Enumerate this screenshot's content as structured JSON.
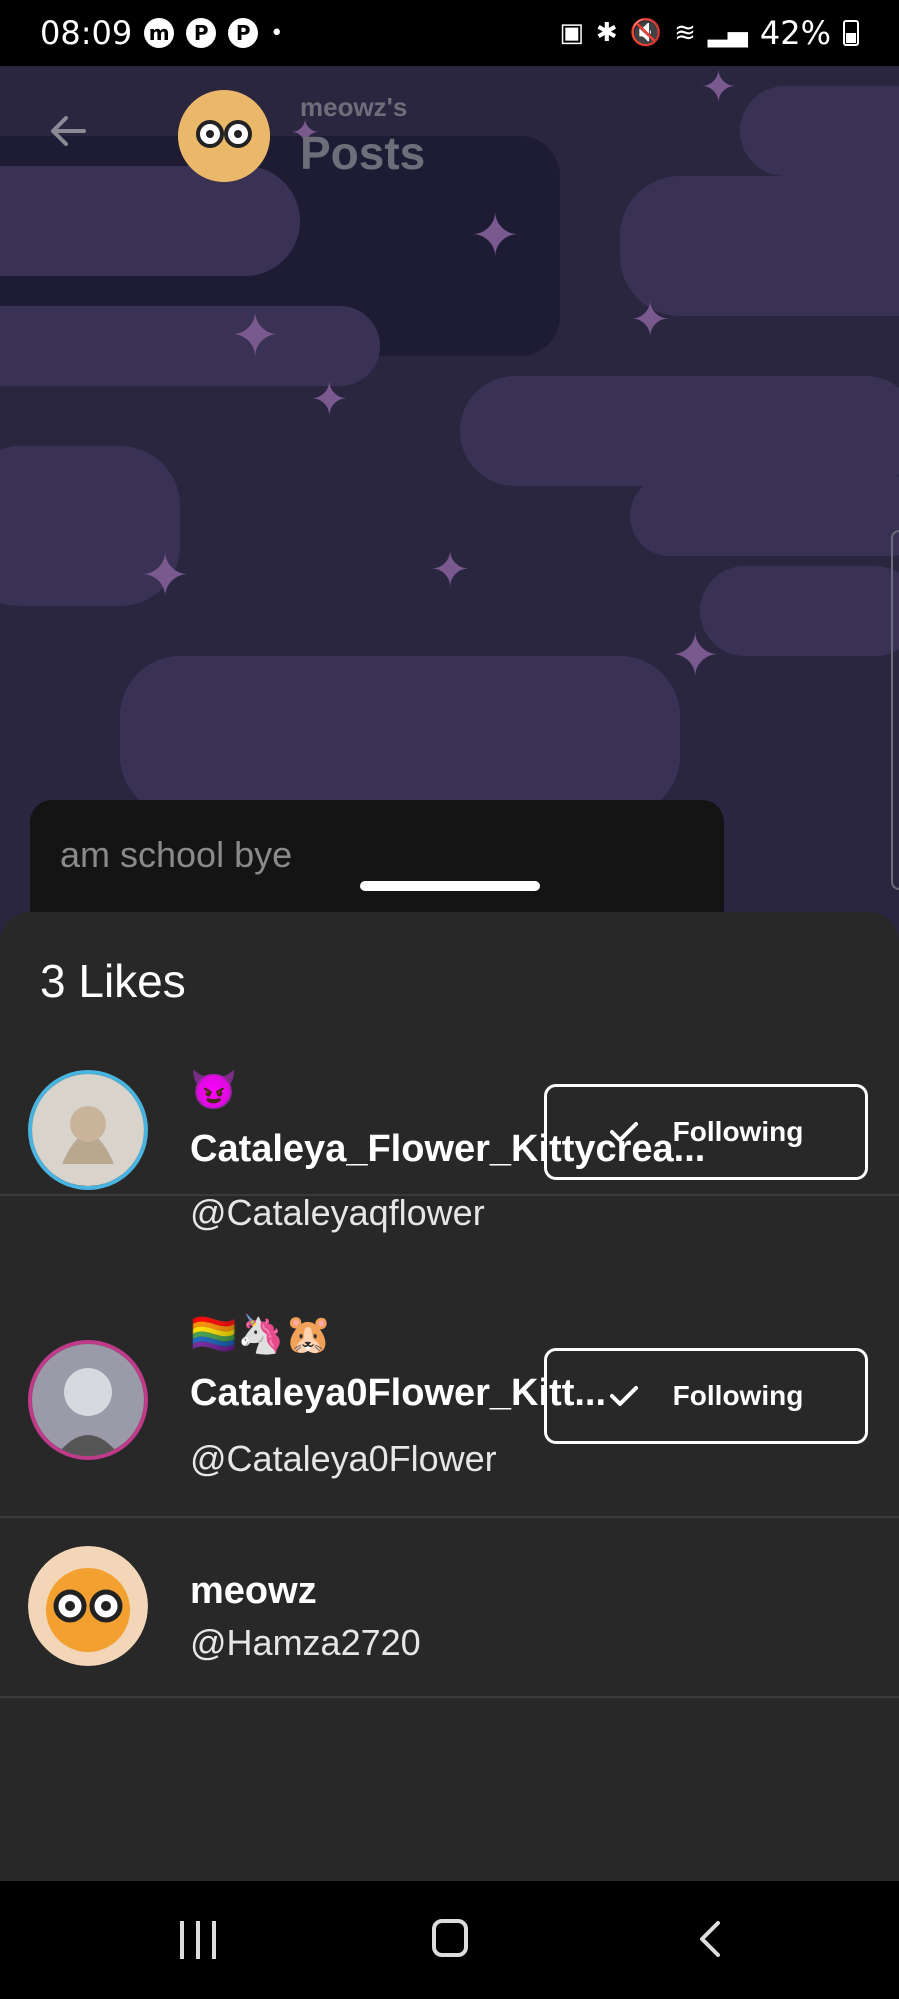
{
  "status_bar": {
    "time": "08:09",
    "app_icons": [
      "m",
      "P",
      "P"
    ],
    "dot": "•",
    "battery": "42%"
  },
  "header": {
    "subtitle": "meowz's",
    "title": "Posts"
  },
  "post": {
    "text": "am school bye"
  },
  "likes_sheet": {
    "title": "3 Likes",
    "users": [
      {
        "display_name": "😈Cataleya_Flower_Kittycrea...",
        "handle": "@Cataleyaqflower",
        "button": "Following"
      },
      {
        "display_name": "🏳️‍🌈🦄🐹Cataleya0Flower_Kitt...",
        "handle": "@Cataleya0Flower",
        "button": "Following"
      },
      {
        "display_name": "meowz",
        "handle": "@Hamza2720"
      }
    ]
  },
  "colors": {
    "sheet_bg": "#282828",
    "bg_purple": "#2a2640",
    "accent_sparkle": "#7a5a8e"
  }
}
